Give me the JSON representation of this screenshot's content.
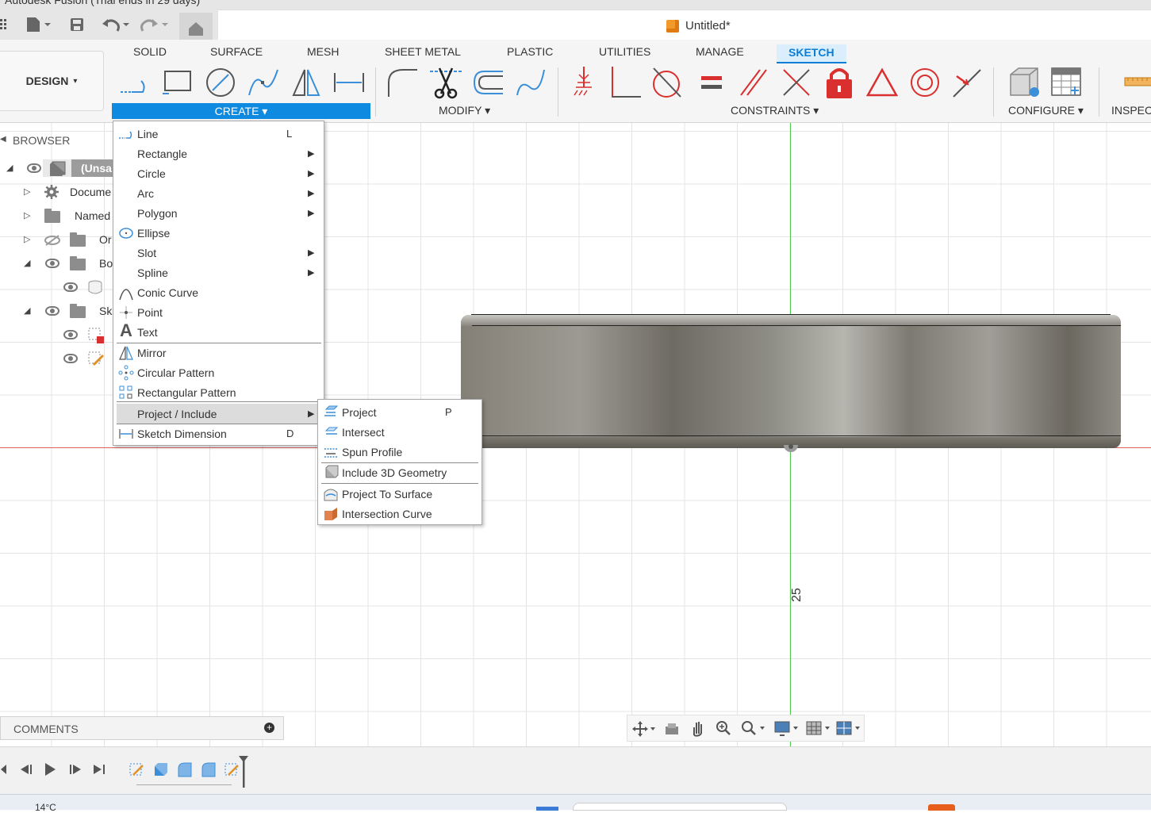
{
  "window": {
    "title_partial": "Autodesk Fusion (Trial ends in 29 days)",
    "doc_title": "Untitled*"
  },
  "workspace": {
    "label": "DESIGN",
    "caret": "▾"
  },
  "tabs": [
    "SOLID",
    "SURFACE",
    "MESH",
    "SHEET METAL",
    "PLASTIC",
    "UTILITIES",
    "MANAGE",
    "SKETCH"
  ],
  "active_tab": "SKETCH",
  "groups": {
    "create": "CREATE ▾",
    "modify": "MODIFY ▾",
    "constraints": "CONSTRAINTS ▾",
    "configure": "CONFIGURE ▾",
    "inspect": "INSPEC"
  },
  "browser": {
    "header": "BROWSER",
    "rows": [
      {
        "label": "(Unsa",
        "icon": "component-icon"
      },
      {
        "label": "Docume",
        "icon": "gear-icon"
      },
      {
        "label": "Named",
        "icon": "folder-icon"
      },
      {
        "label": "Or",
        "icon": "folder-icon"
      },
      {
        "label": "Bo",
        "icon": "folder-icon"
      },
      {
        "label": "",
        "icon": "body-icon"
      },
      {
        "label": "Sk",
        "icon": "folder-icon"
      },
      {
        "label": "",
        "icon": "sketch-icon"
      },
      {
        "label": "",
        "icon": "sketch-icon"
      }
    ]
  },
  "create_menu": [
    {
      "label": "Line",
      "shortcut": "L",
      "submenu": false,
      "icon": "line-icon"
    },
    {
      "label": "Rectangle",
      "shortcut": "",
      "submenu": true,
      "icon": ""
    },
    {
      "label": "Circle",
      "shortcut": "",
      "submenu": true,
      "icon": ""
    },
    {
      "label": "Arc",
      "shortcut": "",
      "submenu": true,
      "icon": ""
    },
    {
      "label": "Polygon",
      "shortcut": "",
      "submenu": true,
      "icon": ""
    },
    {
      "label": "Ellipse",
      "shortcut": "",
      "submenu": false,
      "icon": "ellipse-icon"
    },
    {
      "label": "Slot",
      "shortcut": "",
      "submenu": true,
      "icon": ""
    },
    {
      "label": "Spline",
      "shortcut": "",
      "submenu": true,
      "icon": ""
    },
    {
      "label": "Conic Curve",
      "shortcut": "",
      "submenu": false,
      "icon": "conic-curve-icon"
    },
    {
      "label": "Point",
      "shortcut": "",
      "submenu": false,
      "icon": "point-icon"
    },
    {
      "label": "Text",
      "shortcut": "",
      "submenu": false,
      "icon": "text-icon"
    },
    {
      "label": "Mirror",
      "shortcut": "",
      "submenu": false,
      "icon": "mirror-icon"
    },
    {
      "label": "Circular Pattern",
      "shortcut": "",
      "submenu": false,
      "icon": "circular-pattern-icon"
    },
    {
      "label": "Rectangular Pattern",
      "shortcut": "",
      "submenu": false,
      "icon": "rectangular-pattern-icon"
    },
    {
      "label": "Project / Include",
      "shortcut": "",
      "submenu": true,
      "icon": "",
      "highlighted": true
    },
    {
      "label": "Sketch Dimension",
      "shortcut": "D",
      "submenu": false,
      "icon": "sketch-dimension-icon"
    }
  ],
  "project_submenu": [
    {
      "label": "Project",
      "shortcut": "P",
      "icon": "project-icon"
    },
    {
      "label": "Intersect",
      "shortcut": "",
      "icon": "intersect-icon"
    },
    {
      "label": "Spun Profile",
      "shortcut": "",
      "icon": "spun-profile-icon"
    },
    {
      "label": "Include 3D Geometry",
      "shortcut": "",
      "icon": "include-3d-geometry-icon"
    },
    {
      "label": "Project To Surface",
      "shortcut": "",
      "icon": "project-to-surface-icon"
    },
    {
      "label": "Intersection Curve",
      "shortcut": "",
      "icon": "intersection-curve-icon"
    }
  ],
  "canvas": {
    "dimension_label": "25"
  },
  "comments": {
    "label": "COMMENTS"
  },
  "taskbar": {
    "weather": "14°C"
  },
  "colors": {
    "accent": "#0e8be0",
    "axis_x": "#e06060",
    "axis_y": "#50c850",
    "constraint_red": "#d9302f"
  }
}
